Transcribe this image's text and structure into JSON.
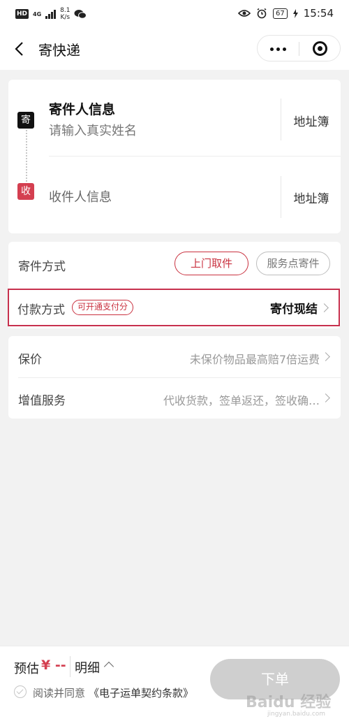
{
  "status_bar": {
    "hd": "HD",
    "network": "4G",
    "speed_value": "8.1",
    "speed_unit": "K/s",
    "battery": "67",
    "time": "15:54",
    "icons": [
      "signal-icon",
      "wechat-icon",
      "eye-icon",
      "alarm-icon",
      "battery-icon",
      "charging-icon"
    ]
  },
  "nav": {
    "title": "寄快递",
    "icons": [
      "back-icon",
      "more-icon",
      "close-miniprogram-icon"
    ]
  },
  "address": {
    "sender_badge": "寄",
    "sender_title": "寄件人信息",
    "sender_placeholder": "请输入真实姓名",
    "receiver_badge": "收",
    "receiver_placeholder": "收件人信息",
    "address_book": "地址簿"
  },
  "shipping": {
    "label": "寄件方式",
    "options": [
      "上门取件",
      "服务点寄件"
    ],
    "selected": "上门取件"
  },
  "payment": {
    "label": "付款方式",
    "tag": "可开通支付分",
    "value": "寄付现结"
  },
  "extras": [
    {
      "label": "保价",
      "value": "未保价物品最高赔7倍运费"
    },
    {
      "label": "增值服务",
      "value": "代收货款，签单返还，签收确…"
    }
  ],
  "footer": {
    "estimate_label": "预估",
    "estimate_price": "¥ --",
    "detail": "明细",
    "agree_text": "阅读并同意",
    "agree_link": "《电子运单契约条款》",
    "order_button": "下单",
    "watermark": "Baidu 经验",
    "watermark_sub": "jingyan.baidu.com"
  },
  "colors": {
    "accent": "#c9313f",
    "receiver_badge": "#d43f50",
    "sender_badge": "#111111",
    "disabled_button": "#cfcfcf",
    "page_bg": "#f2f2f2"
  }
}
